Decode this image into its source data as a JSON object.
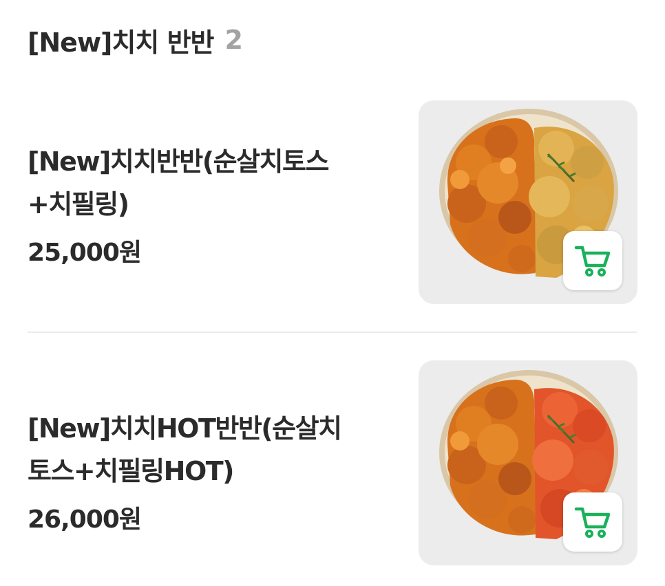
{
  "section": {
    "title": "[New]치치 반반",
    "count": "2"
  },
  "items": [
    {
      "name_line1": "[New]치치반반(순살치토스",
      "name_line2": "+치필링)",
      "price": "25,000원",
      "image_icon": "chicken-platter-half-half",
      "cart_icon": "cart-icon"
    },
    {
      "name_line1": "[New]치치HOT반반(순살치",
      "name_line2": "토스+치필링HOT)",
      "price": "26,000원",
      "image_icon": "chicken-platter-half-half-hot",
      "cart_icon": "cart-icon"
    }
  ],
  "colors": {
    "accent_green": "#19b15a",
    "thumb_bg": "#ececec",
    "text": "#2b2b2b",
    "count": "#a3a3a3"
  }
}
